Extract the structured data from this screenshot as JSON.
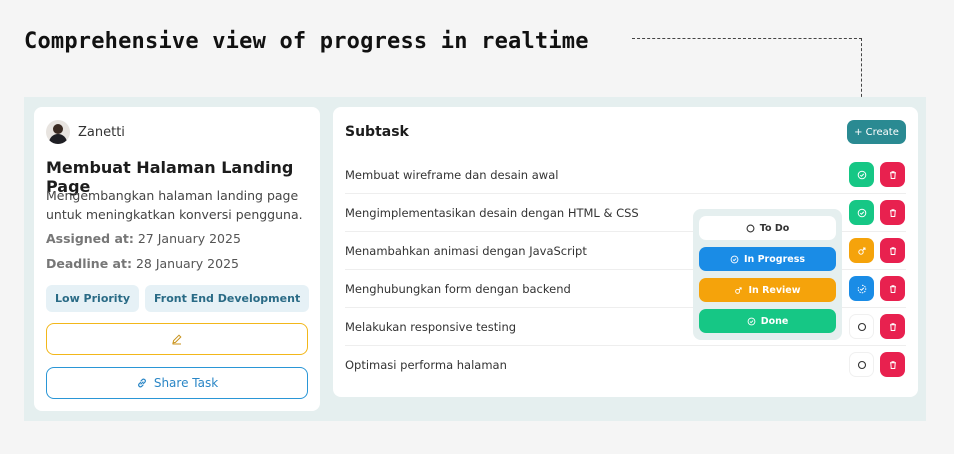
{
  "headline": "Comprehensive view of progress in realtime",
  "task": {
    "user_name": "Zanetti",
    "title": "Membuat Halaman Landing Page",
    "description": "Mengembangkan halaman landing page untuk meningkatkan konversi pengguna.",
    "assigned_label": "Assigned at:",
    "assigned_value": "27 January 2025",
    "deadline_label": "Deadline at:",
    "deadline_value": "28 January 2025",
    "tags": [
      "Low Priority",
      "Front End Development"
    ],
    "share_label": "Share Task",
    "edit_icon": "pencil-icon",
    "share_icon": "link-icon"
  },
  "subtasks": {
    "heading": "Subtask",
    "create_label": "+ Create",
    "items": [
      {
        "label": "Membuat wireframe dan desain awal",
        "status": "done"
      },
      {
        "label": "Mengimplementasikan desain dengan HTML & CSS",
        "status": "done"
      },
      {
        "label": "Menambahkan animasi dengan JavaScript",
        "status": "in_review"
      },
      {
        "label": "Menghubungkan form dengan backend",
        "status": "in_progress"
      },
      {
        "label": "Melakukan responsive testing",
        "status": "todo"
      },
      {
        "label": "Optimasi performa halaman",
        "status": "todo"
      }
    ]
  },
  "status_menu": {
    "todo": "To Do",
    "in_progress": "In Progress",
    "in_review": "In Review",
    "done": "Done"
  },
  "colors": {
    "done": "#16c785",
    "in_review": "#f5a30b",
    "in_progress": "#1a8ce6",
    "delete": "#e8214f",
    "create": "#2a8a92"
  }
}
